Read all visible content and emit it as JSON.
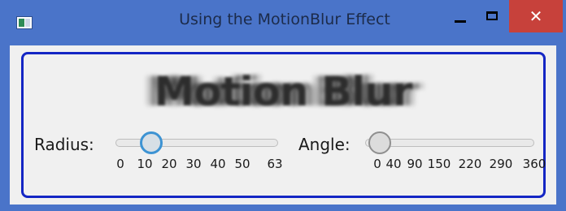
{
  "window": {
    "title": "Using the MotionBlur Effect",
    "close_glyph": "✕",
    "controls": [
      "app-icon",
      "minimize-icon",
      "maximize-icon",
      "close-icon"
    ]
  },
  "effect_text": "Motion Blur",
  "radius": {
    "label": "Radius:",
    "value": 10,
    "min": 0,
    "max": 63,
    "ticks": [
      "0",
      "10",
      "20",
      "30",
      "40",
      "50",
      "63"
    ]
  },
  "angle": {
    "label": "Angle:",
    "value": 0,
    "min": 0,
    "max": 360,
    "ticks": [
      "0",
      "40",
      "90",
      "150",
      "220",
      "290",
      "360"
    ]
  },
  "colors": {
    "titlebar": "#4a74c9",
    "close_button": "#c7413b",
    "frame_border": "#1426c4",
    "active_thumb": "#3d93d3"
  }
}
